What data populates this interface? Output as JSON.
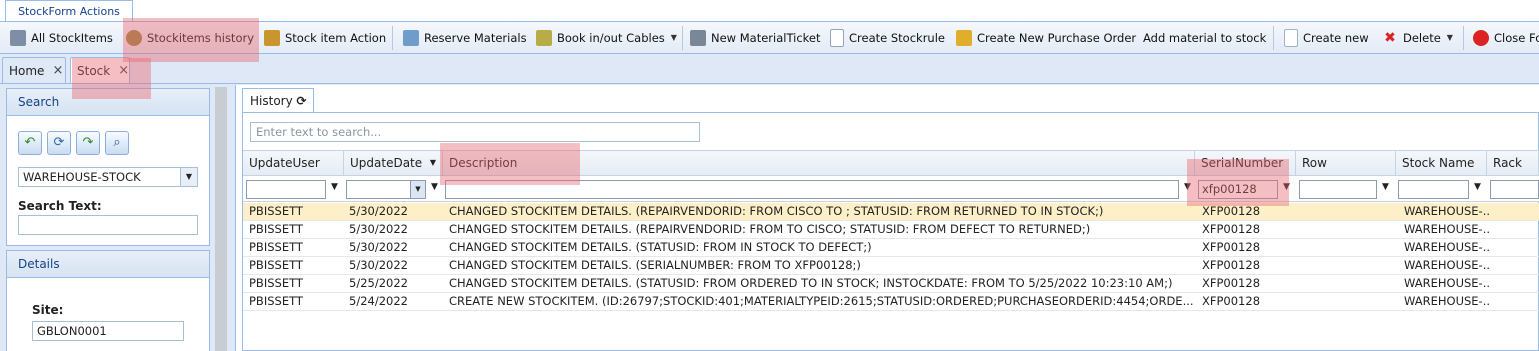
{
  "ribbon_tab": "StockForm Actions",
  "toolbar": {
    "items": [
      {
        "label": "All StockItems",
        "icon": "stack-icon",
        "color": "#6b7f99"
      },
      {
        "label": "Stockitems history",
        "icon": "history-icon",
        "color": "#8b7a3a"
      },
      {
        "label": "Stock item Action",
        "icon": "action-icon",
        "color": "#c28a2b"
      },
      {
        "label": "Reserve Materials",
        "icon": "clipboard-icon",
        "color": "#5c8fc4"
      },
      {
        "label": "Book in/out Cables",
        "icon": "cable-icon",
        "color": "#b0a43c"
      },
      {
        "label": "New MaterialTicket",
        "icon": "ticket-icon",
        "color": "#6d7a8a"
      },
      {
        "label": "Create Stockrule",
        "icon": "document-icon",
        "color": "#8fa6c0"
      },
      {
        "label": "Create New Purchase Order",
        "icon": "order-icon",
        "color": "#d9a521"
      },
      {
        "label": "Add material to stock",
        "icon": "",
        "color": ""
      },
      {
        "label": "Create new",
        "icon": "new-document-icon",
        "color": "#9fb3cc"
      },
      {
        "label": "Delete",
        "icon": "delete-icon",
        "color": "#d22"
      },
      {
        "label": "Close Fo",
        "icon": "close-form-icon",
        "color": "#d22"
      }
    ]
  },
  "doc_tabs": [
    {
      "label": "Home",
      "close": "×"
    },
    {
      "label": "Stock",
      "close": "×"
    }
  ],
  "left": {
    "search_title": "Search",
    "warehouse_value": "WAREHOUSE-STOCK",
    "search_text_label": "Search Text:",
    "search_text_value": "",
    "details_title": "Details",
    "site_label": "Site:",
    "site_value": "GBLON0001"
  },
  "history_tab": "History",
  "grid": {
    "search_placeholder": "Enter text to search...",
    "columns": [
      "UpdateUser",
      "UpdateDate",
      "Description",
      "SerialNumber",
      "Row",
      "Stock Name",
      "Rack"
    ],
    "filter_serial": "xfp00128",
    "rows": [
      [
        "PBISSETT",
        "5/30/2022",
        "CHANGED STOCKITEM DETAILS. (REPAIRVENDORID: FROM CISCO TO ; STATUSID: FROM RETURNED TO IN STOCK;)",
        "XFP00128",
        "",
        "WAREHOUSE-...",
        ""
      ],
      [
        "PBISSETT",
        "5/30/2022",
        "CHANGED STOCKITEM DETAILS. (REPAIRVENDORID: FROM TO CISCO; STATUSID: FROM DEFECT TO RETURNED;)",
        "XFP00128",
        "",
        "WAREHOUSE-...",
        ""
      ],
      [
        "PBISSETT",
        "5/30/2022",
        "CHANGED STOCKITEM DETAILS. (STATUSID: FROM IN STOCK TO DEFECT;)",
        "XFP00128",
        "",
        "WAREHOUSE-...",
        ""
      ],
      [
        "PBISSETT",
        "5/30/2022",
        "CHANGED STOCKITEM DETAILS. (SERIALNUMBER: FROM TO XFP00128;)",
        "XFP00128",
        "",
        "WAREHOUSE-...",
        ""
      ],
      [
        "PBISSETT",
        "5/25/2022",
        "CHANGED STOCKITEM DETAILS. (STATUSID: FROM ORDERED TO IN STOCK; INSTOCKDATE: FROM TO 5/25/2022 10:23:10 AM;)",
        "XFP00128",
        "",
        "WAREHOUSE-...",
        ""
      ],
      [
        "PBISSETT",
        "5/24/2022",
        "CREATE NEW STOCKITEM. (ID:26797;STOCKID:401;MATERIALTYPEID:2615;STATUSID:ORDERED;PURCHASEORDERID:4454;ORDE...",
        "XFP00128",
        "",
        "WAREHOUSE-...",
        ""
      ]
    ]
  },
  "highlight_color": "#e8646e"
}
